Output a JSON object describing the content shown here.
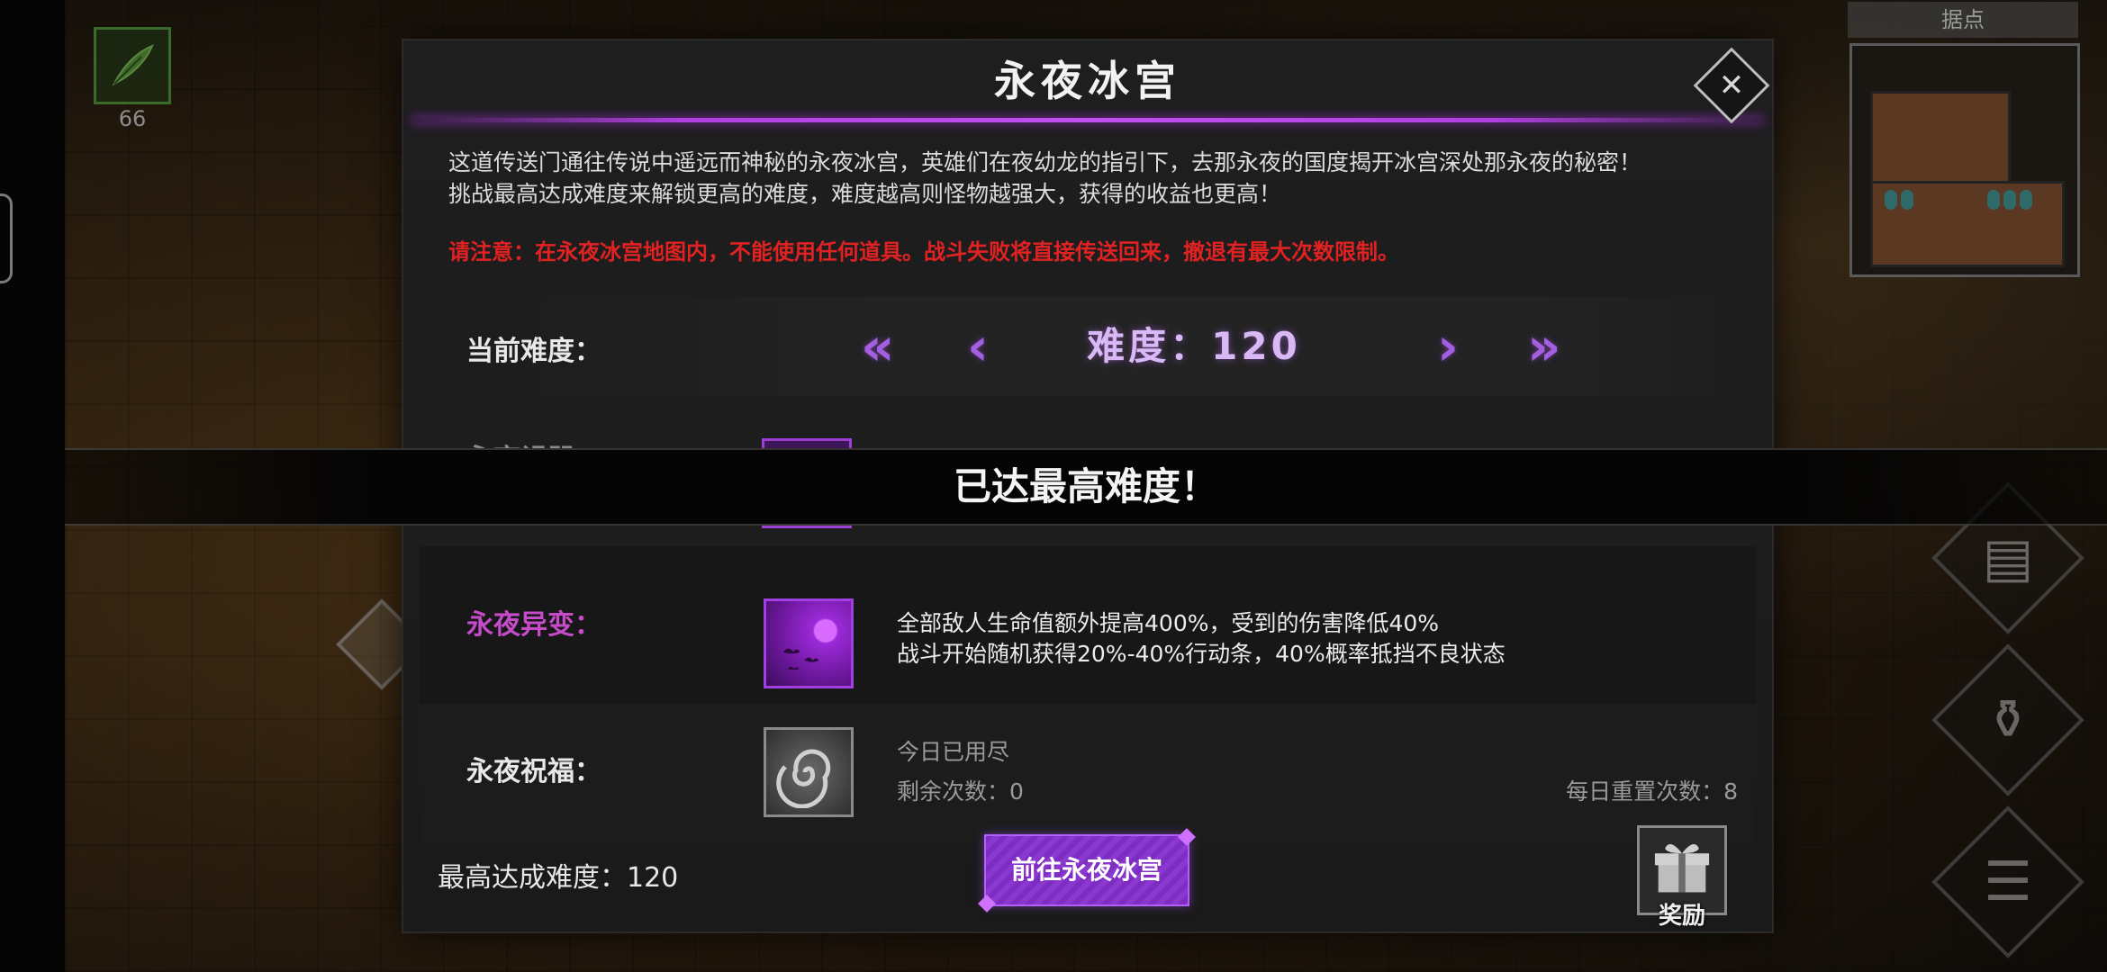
{
  "hud": {
    "item_count": "66"
  },
  "minimap": {
    "title": "据点"
  },
  "dialog": {
    "title": "永夜冰宫",
    "close_icon": "close-icon",
    "description": [
      "这道传送门通往传说中遥远而神秘的永夜冰宫，英雄们在夜幼龙的指引下，去那永夜的国度揭开冰宫深处那永夜的秘密！",
      "挑战最高达成难度来解锁更高的难度，难度越高则怪物越强大，获得的收益也更高！"
    ],
    "warning": "请注意：在永夜冰宫地图内，不能使用任何道具。战斗失败将直接传送回来，撤退有最大次数限制。",
    "difficulty": {
      "label": "当前难度：",
      "value_text": "难度：120",
      "first_arrow": "«",
      "prev_arrow": "‹",
      "next_arrow": "›",
      "last_arrow": "»"
    },
    "curse": {
      "label": "永夜诅咒"
    },
    "mutation": {
      "label": "永夜异变：",
      "line1": "全部敌人生命值额外提高400%，受到的伤害降低40%",
      "line2": "战斗开始随机获得20%-40%行动条，40%概率抵挡不良状态"
    },
    "blessing": {
      "label": "永夜祝福：",
      "status": "今日已用尽",
      "remaining": "剩余次数：0",
      "daily_reset": "每日重置次数：8"
    },
    "footer": {
      "max_difficulty": "最高达成难度：120",
      "go_button": "前往永夜冰宫",
      "reward_label": "奖励"
    }
  },
  "banner": {
    "text": "已达最高难度！"
  },
  "colors": {
    "accent": "#a040e0",
    "warning": "#e02222",
    "mutation_label": "#c64bc9"
  }
}
